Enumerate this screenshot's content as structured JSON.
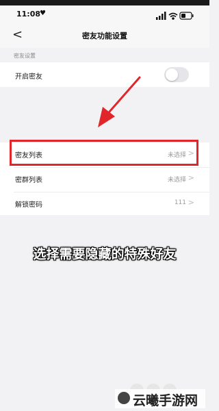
{
  "status": {
    "time": "11:08",
    "heart_icon": "heart-icon",
    "signal_icon": "cellular-signal-icon",
    "wifi_icon": "wifi-icon",
    "battery_icon": "battery-icon"
  },
  "nav": {
    "back_icon": "chevron-left-icon",
    "back_glyph": "<",
    "title": "密友功能设置"
  },
  "section": {
    "label": "密友设置"
  },
  "toggle_row": {
    "label": "开启密友",
    "enabled": false
  },
  "list": [
    {
      "label": "密友列表",
      "value": "未选择",
      "chevron": ">"
    },
    {
      "label": "密群列表",
      "value": "未选择",
      "chevron": ">"
    },
    {
      "label": "解锁密码",
      "value": "111",
      "chevron": ">"
    }
  ],
  "caption": "选择需要隐藏的特殊好友",
  "watermark": {
    "text": "云曦手游网"
  },
  "colors": {
    "highlight": "#e0262b",
    "background": "#f2f2f4"
  }
}
